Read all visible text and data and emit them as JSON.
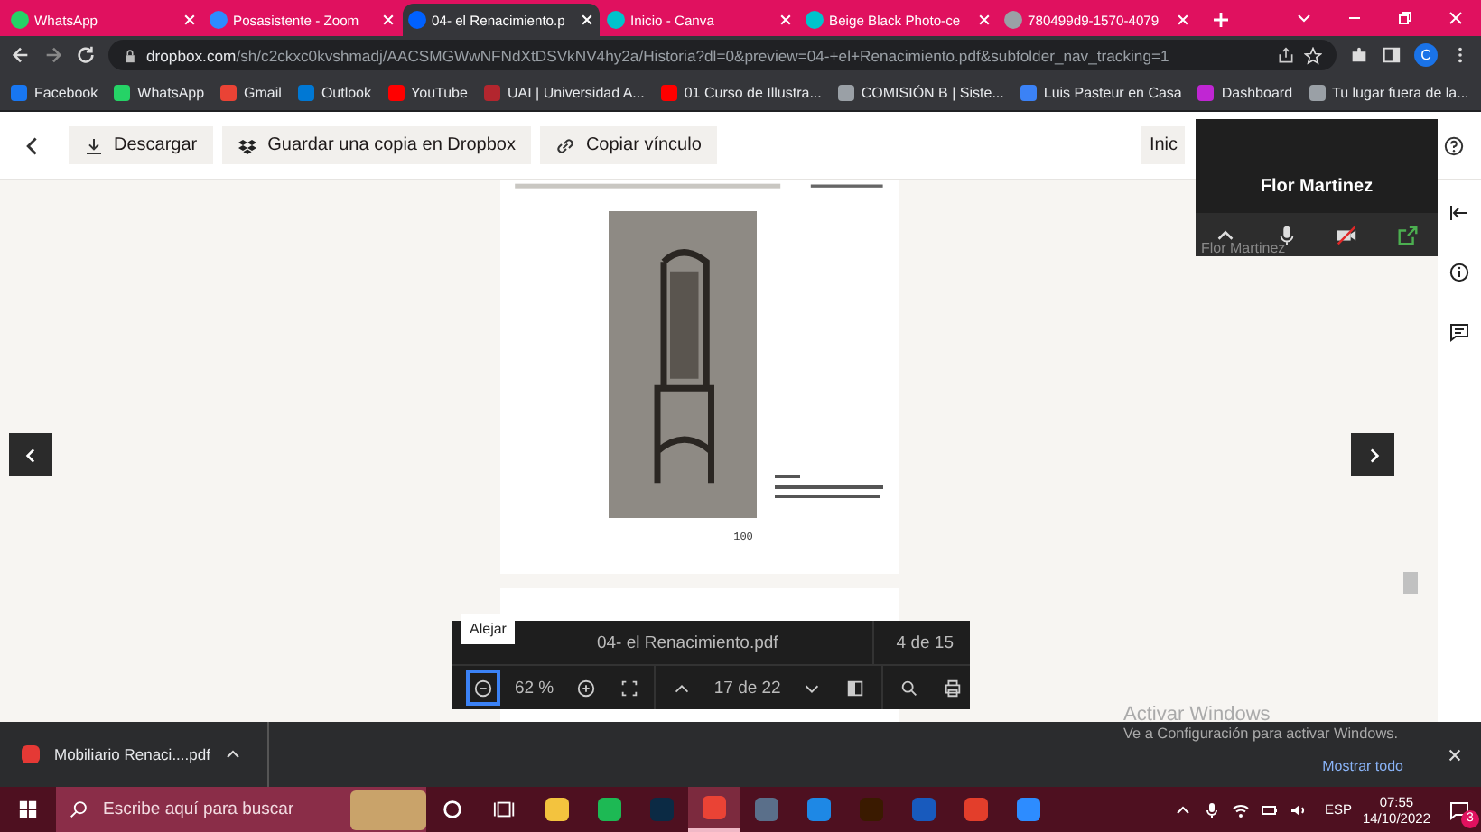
{
  "browser": {
    "tabs": [
      {
        "title": "WhatsApp",
        "selected": false
      },
      {
        "title": "Posasistente - Zoom",
        "selected": false
      },
      {
        "title": "04- el Renacimiento.p",
        "selected": true
      },
      {
        "title": "Inicio - Canva",
        "selected": false
      },
      {
        "title": "Beige Black Photo-ce",
        "selected": false
      },
      {
        "title": "780499d9-1570-4079",
        "selected": false
      }
    ],
    "address": {
      "host": "dropbox.com",
      "path": "/sh/c2ckxc0kvshmadj/AACSMGWwNFNdXtDSVkNV4hy2a/Historia?dl=0&preview=04-+el+Renacimiento.pdf&subfolder_nav_tracking=1"
    },
    "profile": "C",
    "bookmarks": [
      "Facebook",
      "WhatsApp",
      "Gmail",
      "Outlook",
      "YouTube",
      "UAI | Universidad A...",
      "01 Curso de Illustra...",
      "COMISIÓN B | Siste...",
      "Luis Pasteur en Casa",
      "Dashboard",
      "Tu lugar fuera de la..."
    ]
  },
  "toolbar": {
    "buttons": [
      "Descargar",
      "Guardar una copia en Dropbox",
      "Copiar vínculo"
    ],
    "right_button": "Inic"
  },
  "zoom_window": {
    "name": "Flor Martinez",
    "caption": "Flor Martinez"
  },
  "document": {
    "page_number": "100"
  },
  "pdf_bar": {
    "tooltip": "Alejar",
    "filename": "04- el Renacimiento.pdf",
    "file_position": "4 de 15",
    "zoom": "62 %",
    "page": "17 de 22"
  },
  "activation": {
    "title": "Activar Windows",
    "text": "Ve a Configuración para activar Windows."
  },
  "downloads": {
    "file": "Mobiliario Renaci....pdf",
    "show_all": "Mostrar todo"
  },
  "taskbar": {
    "search_placeholder": "Escribe aquí para buscar",
    "apps": [
      {
        "kind": "cortana",
        "active": false
      },
      {
        "kind": "taskview",
        "active": false
      },
      {
        "kind": "explorer",
        "active": false
      },
      {
        "kind": "spotify",
        "active": false
      },
      {
        "kind": "photoshop",
        "active": false
      },
      {
        "kind": "chrome",
        "active": true
      },
      {
        "kind": "calculator",
        "active": false
      },
      {
        "kind": "calendar",
        "active": false
      },
      {
        "kind": "illustrator",
        "active": false
      },
      {
        "kind": "word",
        "active": false
      },
      {
        "kind": "red",
        "active": false
      },
      {
        "kind": "zoom",
        "active": false
      }
    ],
    "lang": "ESP",
    "time": "07:55",
    "date": "14/10/2022",
    "notifications": "3"
  }
}
